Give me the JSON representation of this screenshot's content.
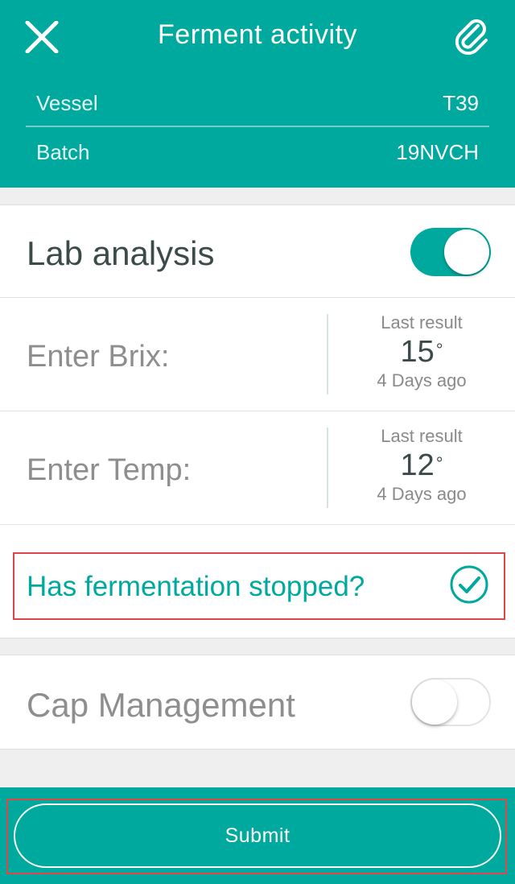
{
  "header": {
    "title": "Ferment activity",
    "close_icon": "close-icon",
    "attach_icon": "paperclip-icon",
    "vessel_label": "Vessel",
    "vessel_value": "T39",
    "batch_label": "Batch",
    "batch_value": "19NVCH"
  },
  "lab": {
    "label": "Lab analysis",
    "enabled": true,
    "brix": {
      "placeholder": "Enter Brix:",
      "last_label": "Last result",
      "last_value": "15",
      "unit": "°",
      "last_time": "4 Days ago"
    },
    "temp": {
      "placeholder": "Enter Temp:",
      "last_label": "Last result",
      "last_value": "12",
      "unit": "°",
      "last_time": "4 Days ago"
    },
    "question": "Has fermentation stopped?",
    "question_checked": true
  },
  "cap": {
    "label": "Cap Management",
    "enabled": false
  },
  "footer": {
    "submit_label": "Submit"
  },
  "colors": {
    "accent": "#00a99d",
    "highlight": "#e0454b"
  }
}
